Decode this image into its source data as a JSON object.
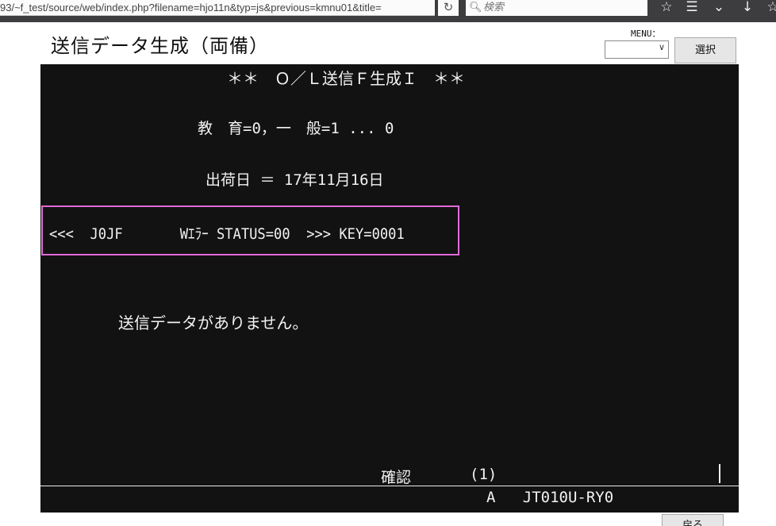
{
  "browser": {
    "url": "93/~f_test/source/web/index.php?filename=hjo11n&typ=js&previous=kmnu01&title=",
    "search_placeholder": "検索"
  },
  "header": {
    "title": "送信データ生成（両備）",
    "menu_label": "MENU：",
    "menu_value": "",
    "select_button": "選択"
  },
  "terminal": {
    "heading": "＊＊　Ｏ／Ｌ送信Ｆ生成Ｉ　＊＊",
    "type_line": "教　育=0，一　般=1 ... 0",
    "ship_date_line": "出荷日 ＝ 17年11月16日",
    "status_line": "<<<  J0JF       Wｴﾗｰ STATUS=00  >>> KEY=0001",
    "message": "送信データがありません。",
    "confirm_label": "確認",
    "confirm_value": "(1)",
    "program_line": "A   JT010U-RY0"
  },
  "footer": {
    "back_button": "戻る"
  }
}
